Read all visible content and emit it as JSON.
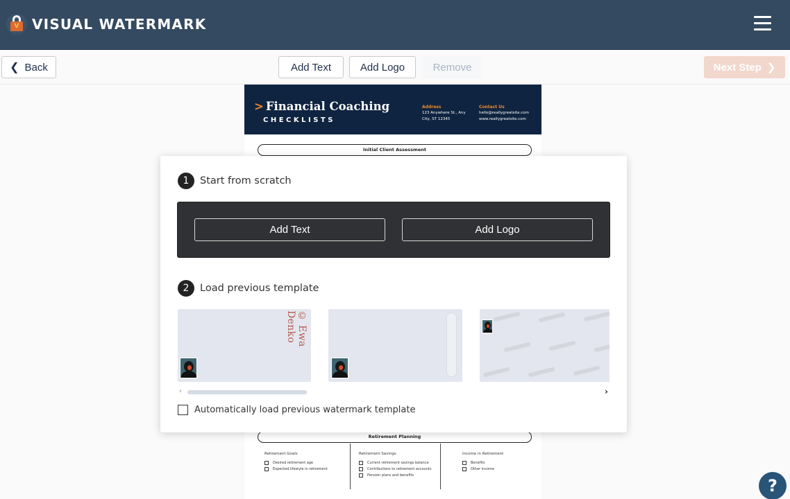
{
  "app": {
    "name": "VISUAL WATERMARK",
    "logo_badge": "V"
  },
  "toolbar": {
    "back_label": "Back",
    "add_text_label": "Add Text",
    "add_logo_label": "Add Logo",
    "remove_label": "Remove",
    "next_step_label": "Next Step"
  },
  "document": {
    "title": "Financial Coaching",
    "title_arrow": ">",
    "subtitle": "CHECKLISTS",
    "address_heading": "Address",
    "address_lines": [
      "123 Anywhere St., Any",
      "City, ST 12345"
    ],
    "contact_heading": "Contact Us",
    "contact_lines": [
      "hello@reallygreatsite.com",
      "www.reallygreatsite.com"
    ],
    "section_1": "Initial Client Assessment",
    "section_2": "Retirement Planning",
    "retirement_columns": [
      {
        "heading": "Retirement Goals",
        "items": [
          "Desired retirement age",
          "Expected lifestyle in retirement"
        ]
      },
      {
        "heading": "Retirement Savings",
        "items": [
          "Current retirement savings balance",
          "Contributions to retirement accounts",
          "Pension plans and benefits"
        ]
      },
      {
        "heading": "Income in Retirement",
        "items": [
          "Benefits",
          "Other income"
        ]
      }
    ]
  },
  "modal": {
    "step1": {
      "number": "1",
      "label": "Start from scratch",
      "add_text_label": "Add Text",
      "add_logo_label": "Add Logo"
    },
    "step2": {
      "number": "2",
      "label": "Load previous template"
    },
    "templates": [
      {
        "name": "template-1",
        "watermark_text": "© Ewa Denko"
      },
      {
        "name": "template-2",
        "watermark_text": ""
      },
      {
        "name": "template-3",
        "watermark_text": ""
      }
    ],
    "scroll_left_icon": "‹",
    "scroll_right_icon": "›",
    "auto_load_label": "Automatically load previous watermark template",
    "auto_load_checked": false
  },
  "help": {
    "icon": "?"
  },
  "colors": {
    "header_bg": "#344a60",
    "accent_orange": "#e06a2e",
    "next_step_disabled": "#f2d7cd",
    "scratch_panel": "#303134",
    "help_button": "#285478"
  }
}
